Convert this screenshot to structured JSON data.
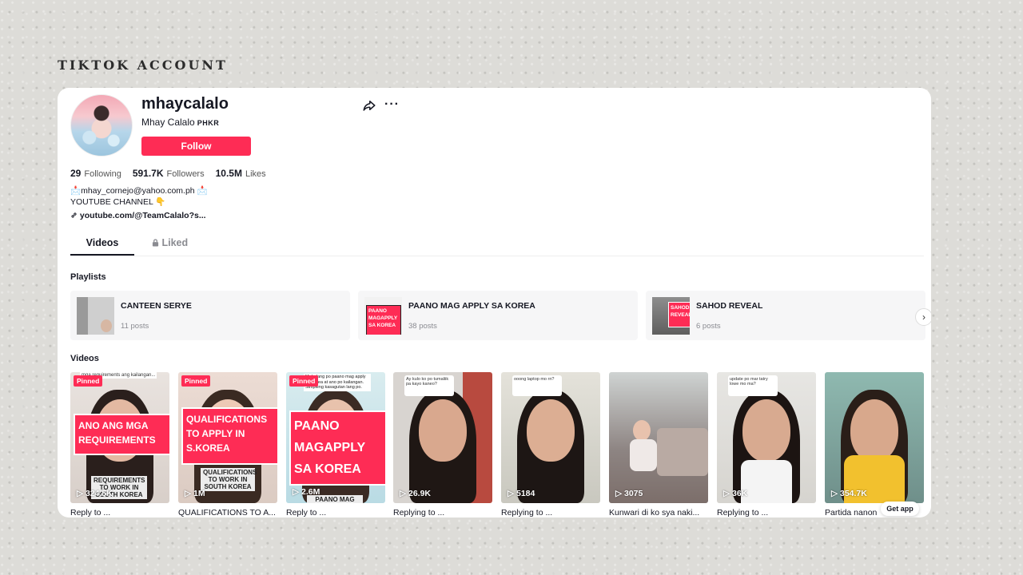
{
  "slide": {
    "title": "TIKTOK ACCOUNT"
  },
  "profile": {
    "username": "mhaycalalo",
    "nickname": "Mhay Calalo",
    "region": "PHKR",
    "follow_label": "Follow",
    "stats": {
      "following_count": "29",
      "following_label": "Following",
      "followers_count": "591.7K",
      "followers_label": "Followers",
      "likes_count": "10.5M",
      "likes_label": "Likes"
    },
    "bio_line1": "📩mhay_cornejo@yahoo.com.ph 📩",
    "bio_line2": "YOUTUBE CHANNEL 👇",
    "link": "youtube.com/@TeamCalalo?s..."
  },
  "tabs": {
    "videos": "Videos",
    "liked": "Liked"
  },
  "playlists": {
    "label": "Playlists",
    "items": [
      {
        "title": "CANTEEN SERYE",
        "count": "11 posts",
        "thumb_text": ""
      },
      {
        "title": "PAANO MAG APPLY SA KOREA",
        "count": "38 posts",
        "thumb_text": "PAANO MAGAPPLY SA KOREA"
      },
      {
        "title": "SAHOD REVEAL",
        "count": "6 posts",
        "thumb_text": "SAHOD REVEAL"
      }
    ]
  },
  "videos": {
    "label": "Videos",
    "items": [
      {
        "views": "324.5K",
        "caption": "Reply to ...",
        "pinned": "Pinned",
        "overlay": "ANO ANG MGA REQUIREMENTS",
        "sub": "REQUIREMENTS TO WORK IN SOUTH KOREA",
        "top_note": "mga requirements ang kailangan..."
      },
      {
        "views": "1M",
        "caption": "QUALIFICATIONS TO A...",
        "pinned": "Pinned",
        "overlay": "QUALIFICATIONS TO APPLY IN S.KOREA",
        "sub": "QUALIFICATIONS TO WORK IN SOUTH KOREA"
      },
      {
        "views": "2.6M",
        "caption": "Reply to ...",
        "pinned": "Pinned",
        "overlay": "PAANO MAGAPPLY SA KOREA",
        "sub": "PAANO MAG APPLY",
        "top_note": "Mabalang po paano mag apply sa Korea at ano po kailangan. Simpleng kasagutan lang po."
      },
      {
        "views": "26.9K",
        "caption": "Replying to ...",
        "bubble": "Ay kulo ko po tumaliik pa kayo kaneo?"
      },
      {
        "views": "5184",
        "caption": "Replying to ...",
        "bubble": "ooong laptop mo rn?"
      },
      {
        "views": "3075",
        "caption": "Kunwari di ko sya naki..."
      },
      {
        "views": "36K",
        "caption": "Replying to ...",
        "bubble": "update po mar tatry lowe mo ma?"
      },
      {
        "views": "354.7K",
        "caption": "Partida nanon"
      }
    ]
  },
  "get_app_label": "Get app",
  "colors": {
    "accent": "#fe2c55",
    "text": "#161823",
    "muted": "#8a8b91"
  }
}
